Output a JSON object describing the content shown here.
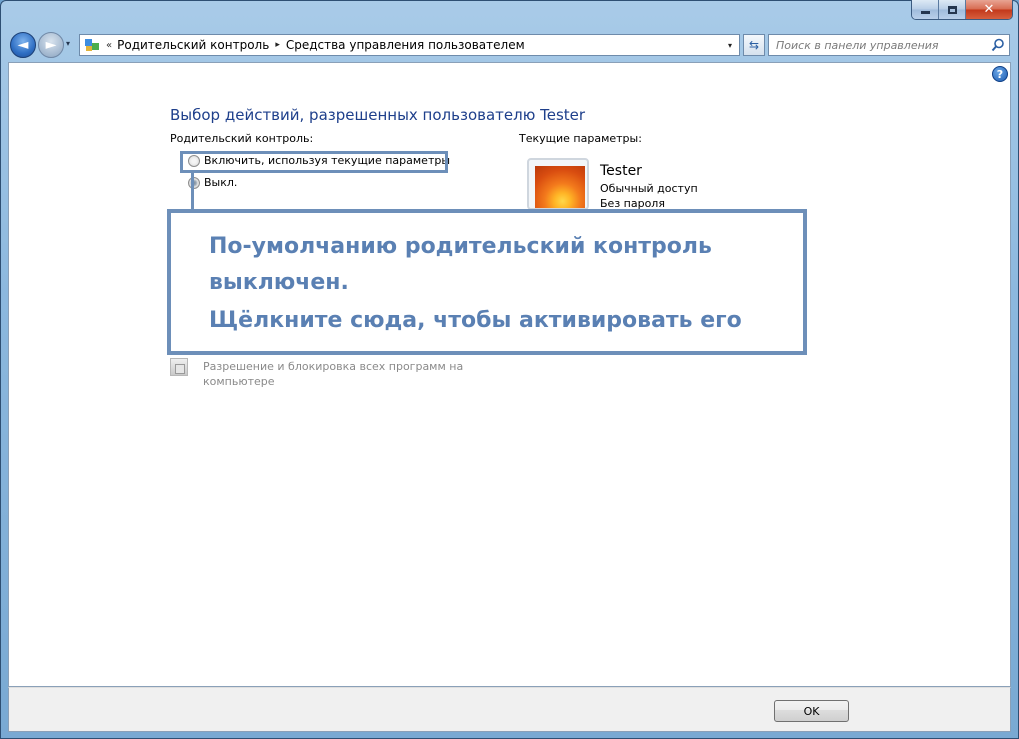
{
  "window": {
    "minimize_label": "_",
    "maximize_label": "□",
    "close_label": "✕"
  },
  "navigation": {
    "back_glyph": "◄",
    "forward_glyph": "►",
    "dropdown_glyph": "▾",
    "crumb_prefix": "«",
    "breadcrumbs": [
      "Родительский контроль",
      "Средства управления пользователем"
    ],
    "separator_glyph": "▸",
    "address_dropdown_glyph": "▾",
    "refresh_glyph": "⇆",
    "search_placeholder": "Поиск в панели управления",
    "search_icon": "magnifier-icon"
  },
  "help_glyph": "?",
  "page": {
    "title": "Выбор действий, разрешенных пользователю Tester",
    "parental_control_label": "Родительский контроль:",
    "options": [
      {
        "label": "Включить, используя текущие параметры",
        "checked": false
      },
      {
        "label": "Выкл.",
        "checked": true
      }
    ],
    "current_params_label": "Текущие параметры:",
    "user": {
      "name": "Tester",
      "account_type": "Обычный доступ",
      "password": "Без пароля"
    },
    "apps_text_line1": "Разрешение и блокировка всех программ на",
    "apps_text_line2": "компьютере"
  },
  "callout": {
    "line1": "По-умолчанию родительский контроль",
    "line2": "выключен.",
    "line3": "Щёлкните сюда, чтобы активировать его"
  },
  "footer": {
    "ok_label": "OK"
  },
  "colors": {
    "title_blue": "#1e3f8b",
    "callout_blue": "#5a80b3",
    "callout_border": "#6d8fb9"
  }
}
